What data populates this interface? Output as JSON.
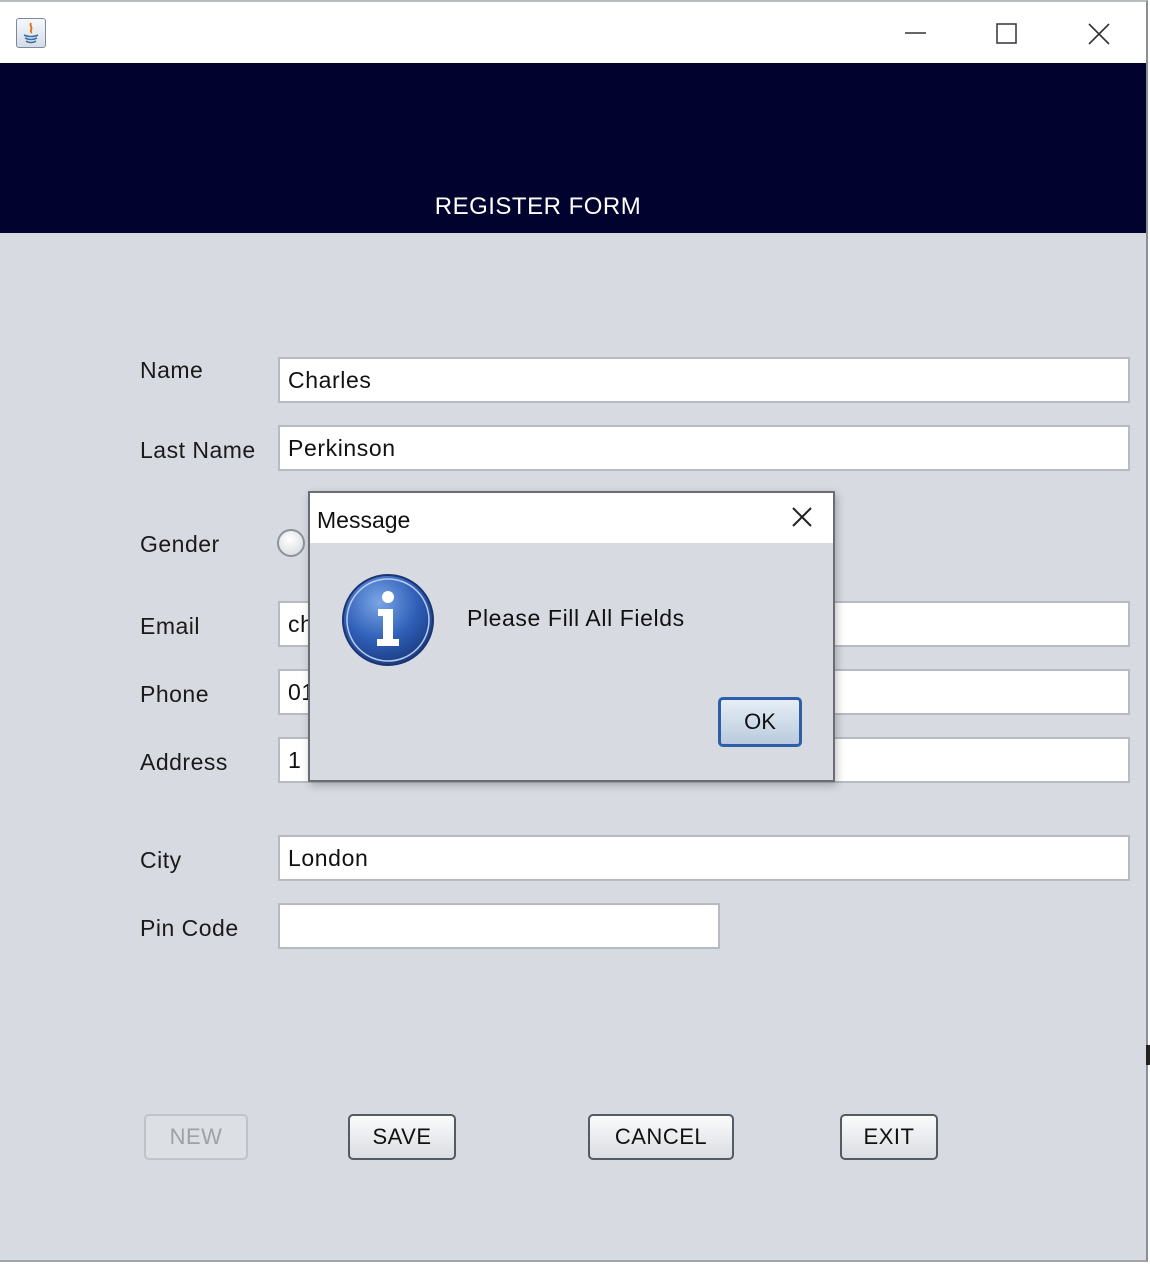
{
  "window": {
    "header_title": "REGISTER FORM",
    "header_bg": "#02022e",
    "controls": [
      "minimize-icon",
      "maximize-icon",
      "close-icon"
    ]
  },
  "form": {
    "name_label": "Name",
    "name_value": "Charles",
    "lastname_label": "Last Name",
    "lastname_value": "Perkinson",
    "gender_label": "Gender",
    "email_label": "Email",
    "email_value": "ch",
    "phone_label": "Phone",
    "phone_value": "01",
    "address_label": "Address",
    "address_value": "1",
    "city_label": "City",
    "city_value": "London",
    "pincode_label": "Pin Code",
    "pincode_value": ""
  },
  "buttons": {
    "new": "NEW",
    "save": "SAVE",
    "cancel": "CANCEL",
    "exit": "EXIT"
  },
  "dialog": {
    "title": "Message",
    "message": "Please Fill All Fields",
    "ok": "OK",
    "icon": "info-icon"
  },
  "colors": {
    "form_bg": "#d7dae1",
    "dialog_border": "#6a6e74",
    "ok_focus": "#2d5ea8"
  }
}
